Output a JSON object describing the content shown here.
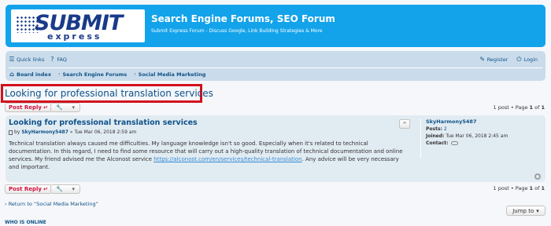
{
  "header": {
    "logo_top": "SUBMIT",
    "logo_bottom": "express",
    "site_title": "Search Engine Forums, SEO Forum",
    "site_desc": "Submit Express Forum - Discuss Google, Link Building Strategies & More",
    "bg_color": "#12a3eb"
  },
  "navbar": {
    "quick_links": "Quick links",
    "faq": "FAQ",
    "register": "Register",
    "login": "Login",
    "breadcrumbs": [
      "Board index",
      "Search Engine Forums",
      "Social Media Marketing"
    ]
  },
  "topic": {
    "title": "Looking for professional translation services",
    "highlight_color": "#d3101c"
  },
  "actions": {
    "post_reply": "Post Reply",
    "pagination_text": "1 post • Page ",
    "page_current": "1",
    "page_of": " of ",
    "page_total": "1"
  },
  "post": {
    "title": "Looking for professional translation services",
    "by": "by",
    "author": "SkyHarmony5487",
    "date": "» Tue Mar 06, 2018 2:59 am",
    "body_text": "Technical translation always caused me difficulties. My language knowledge isn't so good. Especially when it's related to technical documentation. In this regard, I need to find some resource that will carry out a high-quality translation of technical documentation and online services. My friend advised me the Alconost service ",
    "body_link": "https://alconost.com/en/services/technical-translation",
    "body_end": ". Any advice will be very necessary and important.",
    "quote_label": "“",
    "profile": {
      "name": "SkyHarmony5487",
      "posts_label": "Posts:",
      "posts_value": "2",
      "joined_label": "Joined:",
      "joined_value": "Tue Mar 06, 2018 2:45 am",
      "contact_label": "Contact:"
    }
  },
  "footer": {
    "return_link": "Return to “Social Media Marketing”",
    "jump_to": "Jump to",
    "whois": "WHO IS ONLINE"
  }
}
